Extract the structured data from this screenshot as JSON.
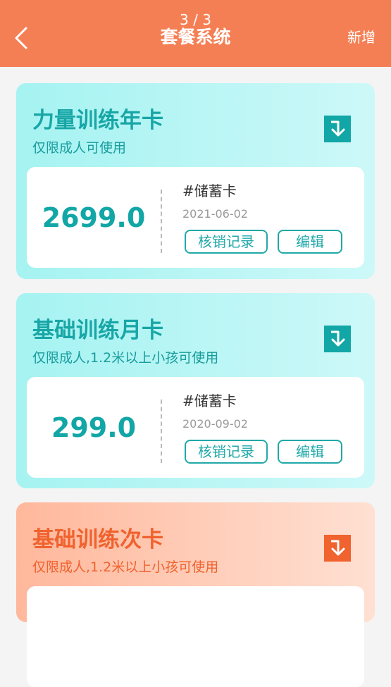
{
  "header": {
    "page_indicator": "3 / 3",
    "title": "套餐系统",
    "add_label": "新增",
    "color": "#f57f54"
  },
  "packages": [
    {
      "title": "力量训练年卡",
      "subtitle": "仅限成人可使用",
      "price": "2699.0",
      "type": "#储蓄卡",
      "date": "2021-06-02",
      "record_label": "核销记录",
      "edit_label": "编辑",
      "theme": "cyan"
    },
    {
      "title": "基础训练月卡",
      "subtitle": "仅限成人,1.2米以上小孩可使用",
      "price": "299.0",
      "type": "#储蓄卡",
      "date": "2020-09-02",
      "record_label": "核销记录",
      "edit_label": "编辑",
      "theme": "cyan"
    },
    {
      "title": "基础训练次卡",
      "subtitle": "仅限成人,1.2米以上小孩可使用",
      "theme": "orange"
    }
  ],
  "colors": {
    "cyan_accent": "#21a8a8",
    "orange_accent": "#f0622e"
  }
}
